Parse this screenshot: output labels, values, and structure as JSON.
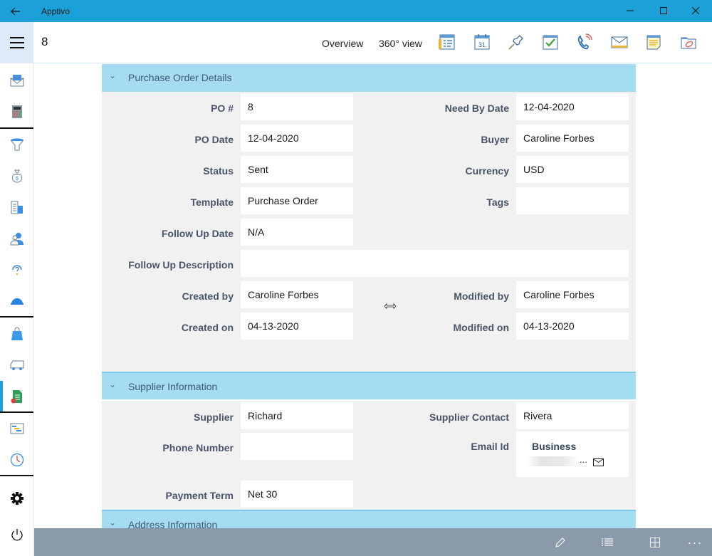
{
  "window": {
    "title": "Apptivo",
    "back_icon": "arrow-left-icon",
    "minimize": "—",
    "maximize": "☐",
    "close": "✕"
  },
  "header": {
    "record_title": "8",
    "links": [
      "Overview",
      "360° view"
    ],
    "action_icons": [
      "overview-list-icon",
      "calendar-icon",
      "pin-icon",
      "task-check-icon",
      "call-icon",
      "email-icon",
      "note-icon",
      "attachment-folder-icon"
    ],
    "calendar_day": "31"
  },
  "sidebar": {
    "items": [
      {
        "icon": "campaigns-envelope-icon"
      },
      {
        "icon": "calculator-icon"
      },
      {
        "icon": "funnel-icon"
      },
      {
        "icon": "money-bag-icon"
      },
      {
        "icon": "buildings-icon"
      },
      {
        "icon": "contacts-icon"
      },
      {
        "icon": "support-headset-icon"
      },
      {
        "icon": "hard-hat-icon"
      },
      {
        "icon": "shopping-bag-icon"
      },
      {
        "icon": "truck-icon"
      },
      {
        "icon": "purchase-order-icon",
        "active": true
      },
      {
        "icon": "gantt-chart-icon"
      },
      {
        "icon": "clock-icon"
      },
      {
        "icon": "settings-gear-icon"
      },
      {
        "icon": "power-icon"
      }
    ]
  },
  "sections": {
    "po_details": {
      "title": "Purchase Order Details",
      "fields": {
        "po_number": {
          "label": "PO #",
          "value": "8"
        },
        "need_by_date": {
          "label": "Need By Date",
          "value": "12-04-2020"
        },
        "po_date": {
          "label": "PO Date",
          "value": "12-04-2020"
        },
        "buyer": {
          "label": "Buyer",
          "value": "Caroline Forbes"
        },
        "status": {
          "label": "Status",
          "value": "Sent"
        },
        "currency": {
          "label": "Currency",
          "value": "USD"
        },
        "template": {
          "label": "Template",
          "value": "Purchase Order"
        },
        "tags": {
          "label": "Tags",
          "value": ""
        },
        "follow_up_date": {
          "label": "Follow Up Date",
          "value": "N/A"
        },
        "follow_up_description": {
          "label": "Follow Up Description",
          "value": ""
        },
        "created_by": {
          "label": "Created by",
          "value": "Caroline Forbes"
        },
        "modified_by": {
          "label": "Modified by",
          "value": "Caroline Forbes"
        },
        "created_on": {
          "label": "Created on",
          "value": "04-13-2020"
        },
        "modified_on": {
          "label": "Modified on",
          "value": "04-13-2020"
        }
      }
    },
    "supplier": {
      "title": "Supplier Information",
      "fields": {
        "supplier": {
          "label": "Supplier",
          "value": "Richard"
        },
        "supplier_contact": {
          "label": "Supplier Contact",
          "value": "Rivera"
        },
        "phone_number": {
          "label": "Phone Number",
          "value": ""
        },
        "email_id": {
          "label": "Email Id",
          "type": "Business",
          "value_suffix": "..."
        },
        "payment_term": {
          "label": "Payment Term",
          "value": "Net 30"
        }
      }
    },
    "address": {
      "title": "Address Information"
    }
  },
  "bottom_bar": {
    "buttons": [
      "edit-pencil-icon",
      "list-view-icon",
      "grid-view-icon",
      "more-options-icon"
    ],
    "more_label": "···"
  },
  "colors": {
    "titlebar": "#1ba1d7",
    "section_header": "#a6dcf2",
    "panel": "#f1f1f1",
    "bottom_bar": "#8a9aab",
    "active_indicator": "#1ba1d7"
  }
}
